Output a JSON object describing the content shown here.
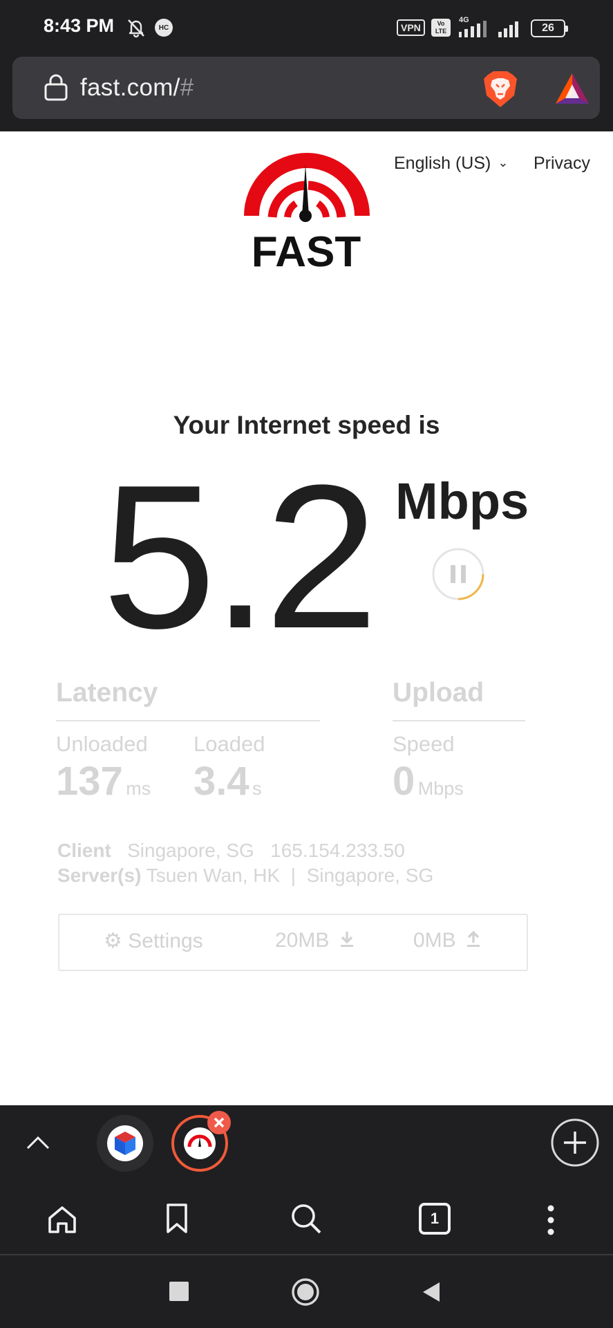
{
  "status_bar": {
    "time": "8:43 PM",
    "hc_label": "HC",
    "vpn_label": "VPN",
    "volte_label_top": "Vo",
    "volte_label_bottom": "LTE",
    "network_label": "4G",
    "battery": "26",
    "icons": [
      "bell-off-icon",
      "hc-icon",
      "vpn-icon",
      "volte-icon",
      "signal-icon",
      "signal-icon",
      "battery-icon"
    ]
  },
  "browser": {
    "url": "fast.com/",
    "url_hash": "#",
    "icons": [
      "lock-icon",
      "brave-shields-icon",
      "bat-rewards-icon"
    ]
  },
  "page": {
    "language": "English (US)",
    "privacy": "Privacy",
    "logo_text": "FAST",
    "speed_title": "Your Internet speed is",
    "speed_value": "5.2",
    "speed_unit": "Mbps",
    "latency": {
      "heading": "Latency",
      "unloaded_label": "Unloaded",
      "unloaded_value": "137",
      "unloaded_unit": "ms",
      "loaded_label": "Loaded",
      "loaded_value": "3.4",
      "loaded_unit": "s"
    },
    "upload": {
      "heading": "Upload",
      "speed_label": "Speed",
      "speed_value": "0",
      "speed_unit": "Mbps"
    },
    "client": {
      "label": "Client",
      "location": "Singapore, SG",
      "ip": "165.154.233.50"
    },
    "servers": {
      "label": "Server(s)",
      "list": "Tsuen Wan, HK  |  Singapore, SG"
    },
    "settings_bar": {
      "settings_label": "Settings",
      "download_size": "20MB",
      "upload_size": "0MB"
    }
  },
  "tab_strip": {
    "tab_count": "1"
  },
  "colors": {
    "fast_red": "#e50914",
    "chrome_dark": "#1f1f21",
    "url_box": "#3b3b3f",
    "faded_text": "#d5d5d5",
    "pause_ring": "#f0b64a"
  }
}
